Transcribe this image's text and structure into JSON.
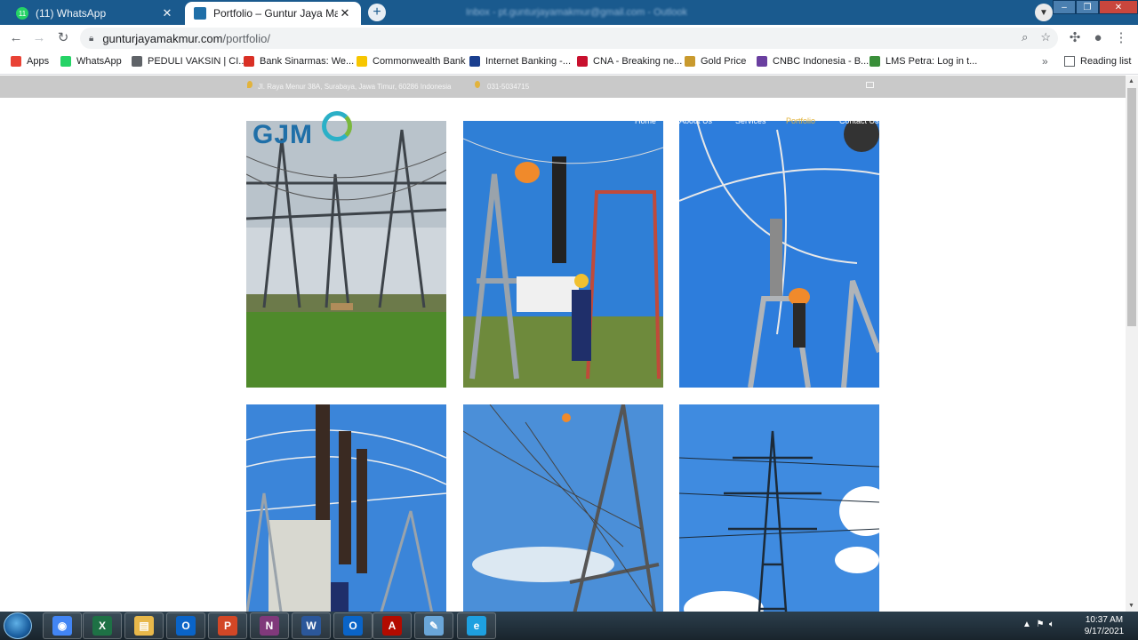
{
  "browser": {
    "tabs": [
      {
        "title": "(11) WhatsApp",
        "badge": "11",
        "active": false
      },
      {
        "title": "Portfolio – Guntur Jaya Makmur",
        "active": true
      }
    ],
    "new_tab": "+",
    "background_tab_text": "Inbox - pt.gunturjayamakmur@gmail.com - Outlook",
    "url_host": "gunturjayamakmur.com",
    "url_path": "/portfolio/"
  },
  "bookmarks": [
    {
      "label": "Apps",
      "color": "#e94235"
    },
    {
      "label": "WhatsApp",
      "color": "#25d366"
    },
    {
      "label": "PEDULI VAKSIN | CI...",
      "color": "#5f6368"
    },
    {
      "label": "Bank Sinarmas: We...",
      "color": "#d93025"
    },
    {
      "label": "Commonwealth Bank",
      "color": "#f7c600"
    },
    {
      "label": "Internet Banking -...",
      "color": "#1a3f8f"
    },
    {
      "label": "CNA - Breaking ne...",
      "color": "#c8102e"
    },
    {
      "label": "Gold Price",
      "color": "#c99a2e"
    },
    {
      "label": "CNBC Indonesia - B...",
      "color": "#6a3fa0"
    },
    {
      "label": "LMS Petra: Log in t...",
      "color": "#3a8f3a"
    }
  ],
  "bookmarks_more": "»",
  "reading_list": "Reading list",
  "site": {
    "address": "Jl. Raya Menur 38A, Surabaya, Jawa Timur, 60286 Indonesia",
    "phone": "031-5034715",
    "logo": "GJM",
    "nav": [
      "Home",
      "About Us",
      "Services",
      "Portfolio",
      "Contact Us"
    ],
    "nav_active": "Portfolio",
    "accent": "#e2b33c"
  },
  "portfolio": [
    {
      "name": "substation-yard"
    },
    {
      "name": "arrester-installation"
    },
    {
      "name": "insulator-maintenance"
    },
    {
      "name": "breaker-bay"
    },
    {
      "name": "gantry-work"
    },
    {
      "name": "transmission-tower"
    }
  ],
  "taskbar": {
    "apps": [
      {
        "name": "chrome",
        "glyph": "◉",
        "color": "#4285f4"
      },
      {
        "name": "excel",
        "glyph": "X",
        "color": "#1e7145"
      },
      {
        "name": "explorer",
        "glyph": "▤",
        "color": "#e8b84a"
      },
      {
        "name": "outlook",
        "glyph": "O",
        "color": "#0a64c8"
      },
      {
        "name": "powerpoint",
        "glyph": "P",
        "color": "#d24726"
      },
      {
        "name": "onenote",
        "glyph": "N",
        "color": "#80397b"
      },
      {
        "name": "word",
        "glyph": "W",
        "color": "#2b579a"
      },
      {
        "name": "outlook-2",
        "glyph": "O",
        "color": "#0a64c8"
      },
      {
        "name": "acrobat",
        "glyph": "A",
        "color": "#b30b00"
      },
      {
        "name": "paint",
        "glyph": "✎",
        "color": "#6aa6d8"
      },
      {
        "name": "internet-explorer",
        "glyph": "e",
        "color": "#1ea0e0"
      }
    ],
    "time": "10:37 AM",
    "date": "9/17/2021"
  }
}
